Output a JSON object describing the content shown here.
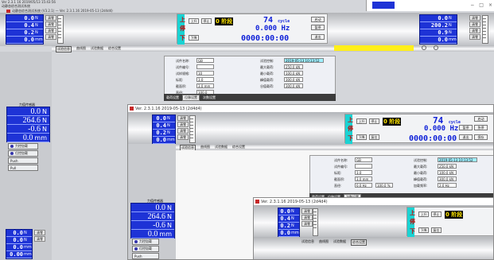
{
  "app": {
    "title": "动静态综合测试系统 (V3.2.1) — Ver. 2.3.1.16 2019-05-13 (2d4d4)",
    "title_short": "Ver. 2.3.1.16 2019-05-13 (2d4d4)",
    "corner_lines": [
      "Ver 2.3.1 16 2019/05/13 15:43:56",
      "动静态综合测试系统"
    ],
    "window_controls": [
      "−",
      "□",
      "×"
    ]
  },
  "readout": {
    "rows": [
      {
        "value": "0.0",
        "unit": "N"
      },
      {
        "value": "0.4",
        "unit": "N"
      },
      {
        "value": "0.2",
        "unit": "N"
      },
      {
        "value": "0.0",
        "unit": "mm"
      }
    ],
    "right_rows": [
      {
        "value": "0.0",
        "unit": "N"
      },
      {
        "value": "200.2",
        "unit": "N"
      },
      {
        "value": "0.9",
        "unit": "N"
      },
      {
        "value": "0.0",
        "unit": "mm"
      }
    ],
    "buttons": [
      "清零",
      "清零",
      "清零",
      "清零"
    ],
    "panel_label": "实时数据"
  },
  "control": {
    "side_labels": [
      "上",
      "停",
      "下"
    ],
    "buttons": [
      "上升",
      "停止",
      "下降",
      "复位"
    ],
    "phase": "0 阶段",
    "cycle_value": "74",
    "cycle_unit": "cycle",
    "freq": "0.000 Hz",
    "time": "0000:00:00",
    "right_buttons": [
      "启动",
      "暂停",
      "急停",
      "退出",
      "保存",
      "帮助"
    ],
    "mini_readout_title": "计数器"
  },
  "tabs": [
    "试验信息",
    "曲线图",
    "试验数据",
    "综合设置"
  ],
  "form": {
    "labels": [
      "试件名称:",
      "试件编号:",
      "试样规格:",
      "标距:",
      "截面积:",
      "直径:",
      "最大力值:",
      "载荷范围:",
      "位移范围:",
      "加载方式:"
    ],
    "values": [
      "GB",
      "",
      "10",
      "3.0",
      "3.0 mm",
      "100.0",
      "200.0",
      "3600",
      "2.0",
      "2.0"
    ],
    "col2_labels": [
      "试验控制:",
      "最大载荷:",
      "最小载荷:",
      "峰值载荷:",
      "谷值载荷:",
      "加载频率:"
    ],
    "col2_values": [
      "2019-05-13 10:13:52",
      "250.0 kN",
      "100.0 kN",
      "300.0 kN",
      "300.0 kN",
      "2.0 Hz"
    ],
    "extra": [
      "0.0 Hz",
      "100.0 %"
    ],
    "bottom_tabs": [
      "载荷设置",
      "位移设置",
      "次数设置"
    ]
  },
  "big_readout": {
    "title": "力值传感器",
    "rows": [
      {
        "value": "0.0",
        "unit": "N"
      },
      {
        "value": "264.6",
        "unit": "N"
      },
      {
        "value": "-0.6",
        "unit": "N"
      },
      {
        "value": "0.0",
        "unit": "mm"
      }
    ]
  },
  "side_buttons": [
    "力控加载",
    "位控加载",
    "Push",
    "Pull"
  ],
  "bottom_left": {
    "rows": [
      {
        "value": "0.0",
        "unit": "N"
      },
      {
        "value": "0.0",
        "unit": "N"
      },
      {
        "value": "0.0",
        "unit": "mm"
      },
      {
        "value": "0.00",
        "unit": "mm"
      }
    ]
  },
  "colors": {
    "readout_blue": "#1e33d6",
    "cyan": "#1ad3d3",
    "yellow": "#ffef1a",
    "phase_text": "#ffe600",
    "lcd_blue": "#0d1fd8"
  }
}
